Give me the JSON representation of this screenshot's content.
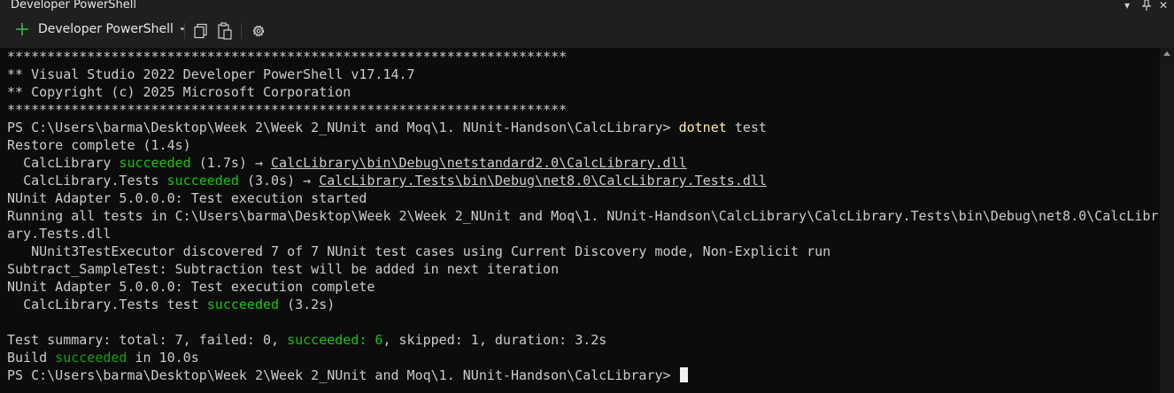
{
  "window": {
    "title": "Developer PowerShell"
  },
  "toolbar": {
    "new_terminal_label": "Developer PowerShell",
    "icons": [
      "plus-icon",
      "chevron-down-icon",
      "copy-icon",
      "paste-icon",
      "gear-icon"
    ]
  },
  "terminal": {
    "lines": [
      "**********************************************************************",
      "** Visual Studio 2022 Developer PowerShell v17.14.7",
      "** Copyright (c) 2025 Microsoft Corporation",
      "**********************************************************************",
      "",
      "Restore complete (1.4s)",
      "",
      "",
      "NUnit Adapter 5.0.0.0: Test execution started",
      "Running all tests in C:\\Users\\barma\\Desktop\\Week 2\\Week 2_NUnit and Moq\\1. NUnit-Handson\\CalcLibrary\\CalcLibrary.Tests\\bin\\Debug\\net8.0\\CalcLibr",
      "ary.Tests.dll",
      "   NUnit3TestExecutor discovered 7 of 7 NUnit test cases using Current Discovery mode, Non-Explicit run",
      "Subtract_SampleTest: Subtraction test will be added in next iteration",
      "NUnit Adapter 5.0.0.0: Test execution complete",
      "",
      "",
      "",
      ""
    ],
    "prompt": "PS C:\\Users\\barma\\Desktop\\Week 2\\Week 2_NUnit and Moq\\1. NUnit-Handson\\CalcLibrary>",
    "command_name": "dotnet",
    "command_arg": "test",
    "build1": {
      "project": "CalcLibrary",
      "status": "succeeded",
      "time": "(1.7s)",
      "arrow": "→",
      "path": "CalcLibrary\\bin\\Debug\\netstandard2.0\\CalcLibrary.dll"
    },
    "build2": {
      "project": "CalcLibrary.Tests",
      "status": "succeeded",
      "time": "(3.0s)",
      "arrow": "→",
      "path": "CalcLibrary.Tests\\bin\\Debug\\net8.0\\CalcLibrary.Tests.dll"
    },
    "test_result": {
      "prefix": "CalcLibrary.Tests test",
      "status": "succeeded",
      "time": "(3.2s)"
    },
    "summary": {
      "prefix": "Test summary: total: 7, failed: 0,",
      "succeeded": "succeeded: 6",
      "suffix": ", skipped: 1, duration: 3.2s"
    },
    "build_final": {
      "prefix": "Build",
      "status": "succeeded",
      "suffix": "in 10.0s"
    }
  }
}
